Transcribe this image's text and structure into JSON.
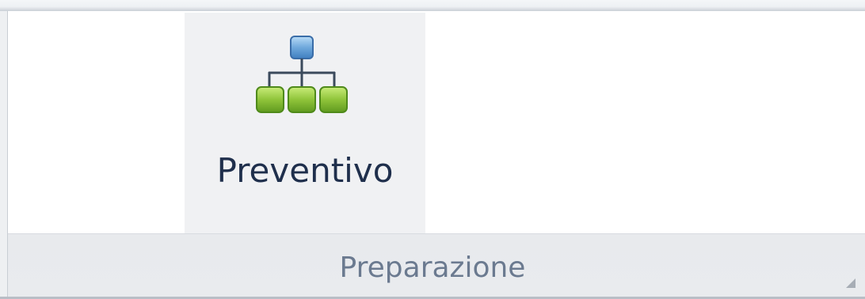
{
  "ribbon": {
    "buttons": [
      {
        "label": "Preventivo",
        "icon": "hierarchy-icon"
      }
    ],
    "group": {
      "title": "Preparazione",
      "launcher_icon": "dialog-launcher-icon"
    }
  },
  "colors": {
    "button_label": "#1f2f4c",
    "group_title": "#6b7a90",
    "button_hover_bg": "#f0f1f3",
    "icon_top_node": "#6fa8dc",
    "icon_child_nodes": "#8fc43a"
  }
}
